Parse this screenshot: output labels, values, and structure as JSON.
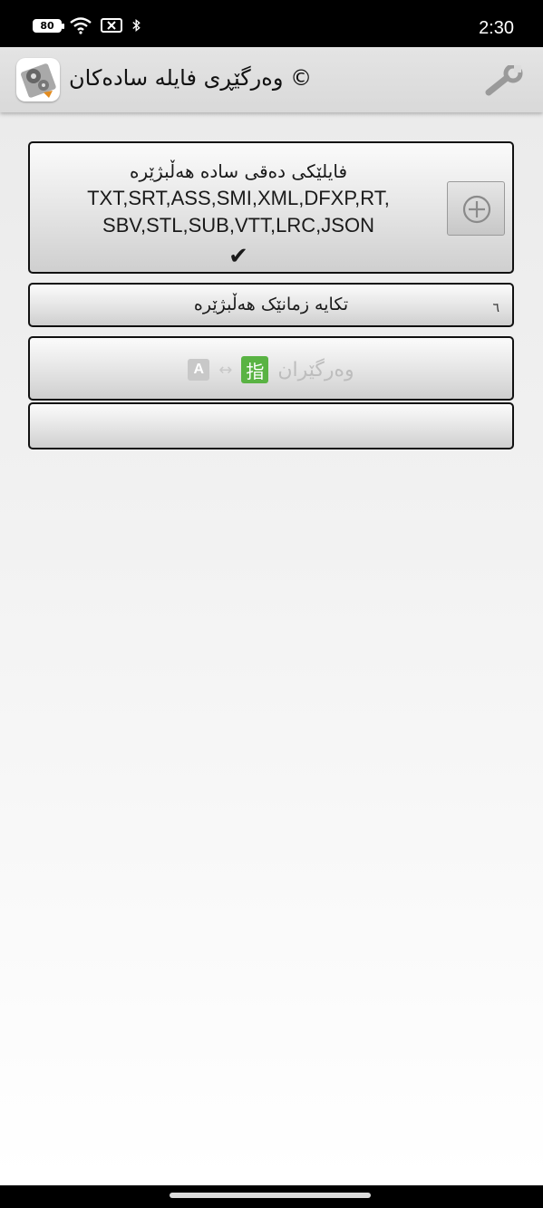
{
  "status_bar": {
    "battery": "80",
    "time": "2:30",
    "icons": [
      "battery-icon",
      "wifi-icon",
      "no-sim-icon",
      "bluetooth-icon"
    ]
  },
  "app_bar": {
    "title": "وەرگێڕی فایلە سادەکان ©",
    "logo_icon": "gears-app-icon",
    "settings_icon": "wrench-icon"
  },
  "file_picker": {
    "heading": "فایلێکی دەقی سادە هەڵبژێرە",
    "formats": "TXT,SRT,ASS,SMI,XML,DFXP,RT,SBV,STL,SUB,VTT,LRC,JSON",
    "checkmark": "✔",
    "add_icon": "plus-circle-icon"
  },
  "language_picker": {
    "label": "تکایە زمانێک هەڵبژێرە",
    "corner_mark": "٦"
  },
  "translate_button": {
    "label": "وەرگێران",
    "icon_a": "A",
    "arrow": "↔",
    "icon_kanji": "指"
  },
  "colors": {
    "status_bar": "#000000",
    "app_bar": "#dcdcdc",
    "card_border": "#111111",
    "translate_badge": "#59b343"
  }
}
